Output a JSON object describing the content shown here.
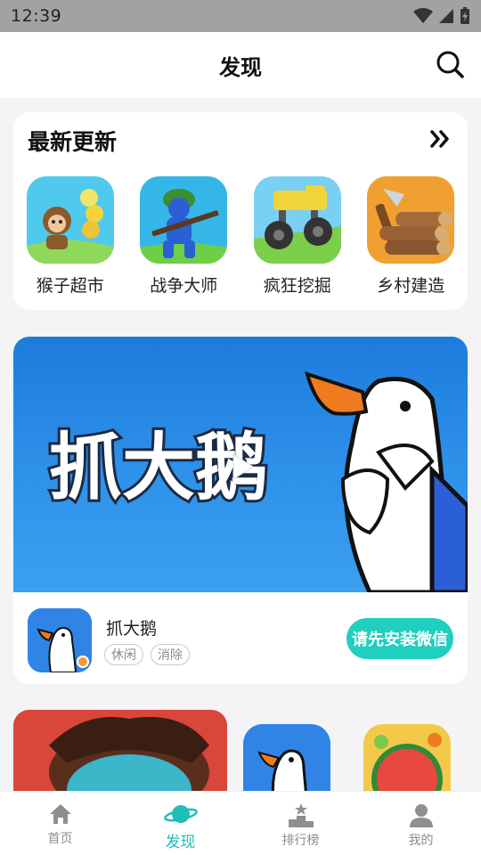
{
  "status_bar": {
    "time": "12:39"
  },
  "header": {
    "title": "发现"
  },
  "recent_section": {
    "title": "最新更新",
    "apps": [
      {
        "name": "猴子超市",
        "icon": "monkey-supermarket-icon"
      },
      {
        "name": "战争大师",
        "icon": "war-master-icon"
      },
      {
        "name": "疯狂挖掘",
        "icon": "crazy-dig-icon"
      },
      {
        "name": "乡村建造",
        "icon": "village-build-icon"
      }
    ]
  },
  "featured": {
    "banner_text": "抓大鹅",
    "name": "抓大鹅",
    "tags": [
      "休闲",
      "消除"
    ],
    "install_label": "请先安装微信"
  },
  "bottom_nav": [
    {
      "label": "首页",
      "icon": "home-icon",
      "active": false
    },
    {
      "label": "发现",
      "icon": "planet-icon",
      "active": true
    },
    {
      "label": "排行榜",
      "icon": "podium-icon",
      "active": false
    },
    {
      "label": "我的",
      "icon": "user-icon",
      "active": false
    }
  ],
  "colors": {
    "accent": "#1fcfbf",
    "nav_active": "#21bdb8",
    "banner_blue": "#2f92ea"
  }
}
